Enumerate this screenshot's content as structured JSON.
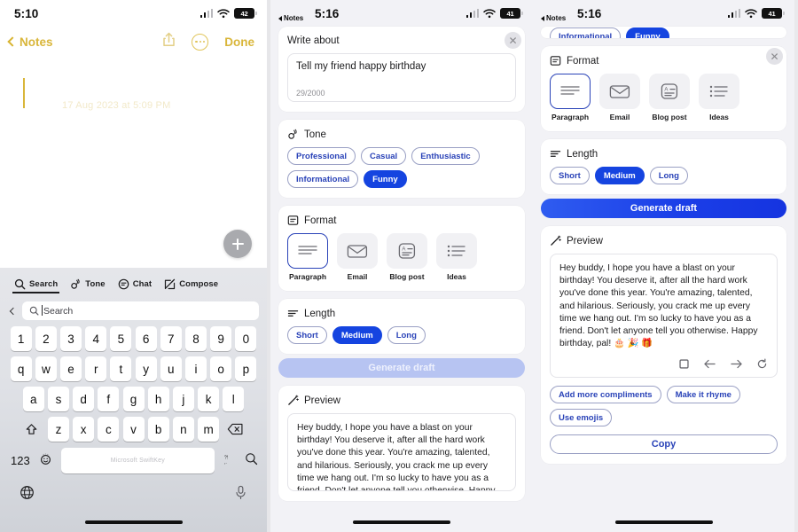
{
  "colors": {
    "accent_blue": "#1544e0",
    "chip_text": "#2a43b8",
    "notes_yellow": "#d9b63a",
    "disabled_blue": "#b7c4f2",
    "panel_bg": "#f2f2f6"
  },
  "panel1": {
    "status": {
      "time": "5:10",
      "battery": "42"
    },
    "nav": {
      "back_label": "Notes",
      "done_label": "Done"
    },
    "note": {
      "watermark": "17 Aug 2023 at 5:09 PM",
      "body_value": ""
    },
    "fab_label": "+",
    "keyboard": {
      "tabs": [
        {
          "label": "Search",
          "icon": "search-icon",
          "active": true
        },
        {
          "label": "Tone",
          "icon": "tone-icon",
          "active": false
        },
        {
          "label": "Chat",
          "icon": "chat-icon",
          "active": false
        },
        {
          "label": "Compose",
          "icon": "compose-icon",
          "active": false
        }
      ],
      "search_field": {
        "value": "",
        "placeholder": "Search"
      },
      "row_numbers": [
        "1",
        "2",
        "3",
        "4",
        "5",
        "6",
        "7",
        "8",
        "9",
        "0"
      ],
      "row_top": [
        "q",
        "w",
        "e",
        "r",
        "t",
        "y",
        "u",
        "i",
        "o",
        "p"
      ],
      "row_home": [
        "a",
        "s",
        "d",
        "f",
        "g",
        "h",
        "j",
        "k",
        "l"
      ],
      "row_bottom": [
        "z",
        "x",
        "c",
        "v",
        "b",
        "n",
        "m"
      ],
      "shift_label": "shift-key",
      "backspace_label": "backspace-key",
      "numeric_label": "123",
      "space_label": "Microsoft SwiftKey",
      "punct_label": "?!,.",
      "globe_label": "globe-key",
      "mic_label": "microphone-key"
    }
  },
  "panel2": {
    "status": {
      "time": "5:16",
      "battery": "41"
    },
    "mini_back": "Notes",
    "write_about": {
      "title": "Write about",
      "value": "Tell my friend happy birthday",
      "placeholder": "Write about",
      "counter": "29/2000"
    },
    "tone": {
      "title": "Tone",
      "options": [
        {
          "label": "Professional",
          "selected": false
        },
        {
          "label": "Casual",
          "selected": false
        },
        {
          "label": "Enthusiastic",
          "selected": false
        },
        {
          "label": "Informational",
          "selected": false
        },
        {
          "label": "Funny",
          "selected": true
        }
      ]
    },
    "format": {
      "title": "Format",
      "options": [
        {
          "label": "Paragraph",
          "icon": "paragraph-icon",
          "selected": true
        },
        {
          "label": "Email",
          "icon": "envelope-icon",
          "selected": false
        },
        {
          "label": "Blog post",
          "icon": "document-icon",
          "selected": false
        },
        {
          "label": "Ideas",
          "icon": "list-icon",
          "selected": false
        }
      ]
    },
    "length": {
      "title": "Length",
      "options": [
        {
          "label": "Short",
          "selected": false
        },
        {
          "label": "Medium",
          "selected": true
        },
        {
          "label": "Long",
          "selected": false
        }
      ]
    },
    "generate_label": "Generate draft",
    "generate_enabled": false,
    "preview": {
      "title": "Preview",
      "text": "Hey buddy, I hope you have a blast on your birthday! You deserve it, after all the hard work you've done this year. You're amazing, talented, and hilarious. Seriously, you crack me up every time we hang out. I'm so lucky to have you as a friend. Don't let anyone tell you otherwise. Happy"
    }
  },
  "panel3": {
    "status": {
      "time": "5:16",
      "battery": "41"
    },
    "mini_back": "Notes",
    "tone_partial": [
      {
        "label": "Informational",
        "selected": false
      },
      {
        "label": "Funny",
        "selected": true
      }
    ],
    "format": {
      "title": "Format",
      "options": [
        {
          "label": "Paragraph",
          "icon": "paragraph-icon",
          "selected": true
        },
        {
          "label": "Email",
          "icon": "envelope-icon",
          "selected": false
        },
        {
          "label": "Blog post",
          "icon": "document-icon",
          "selected": false
        },
        {
          "label": "Ideas",
          "icon": "list-icon",
          "selected": false
        }
      ]
    },
    "length": {
      "title": "Length",
      "options": [
        {
          "label": "Short",
          "selected": false
        },
        {
          "label": "Medium",
          "selected": true
        },
        {
          "label": "Long",
          "selected": false
        }
      ]
    },
    "generate_label": "Generate draft",
    "generate_enabled": true,
    "preview": {
      "title": "Preview",
      "text": "Hey buddy, I hope you have a blast on your birthday! You deserve it, after all the hard work you've done this year. You're amazing, talented, and hilarious. Seriously, you crack me up every time we hang out. I'm so lucky to have you as a friend. Don't let anyone tell you otherwise. Happy birthday, pal! 🎂 🎉 🎁",
      "tools": [
        "copy-icon",
        "arrow-left-icon",
        "arrow-right-icon",
        "regenerate-icon"
      ]
    },
    "suggestions": [
      {
        "label": "Add more compliments"
      },
      {
        "label": "Make it rhyme"
      },
      {
        "label": "Use emojis"
      }
    ],
    "copy_label": "Copy"
  }
}
